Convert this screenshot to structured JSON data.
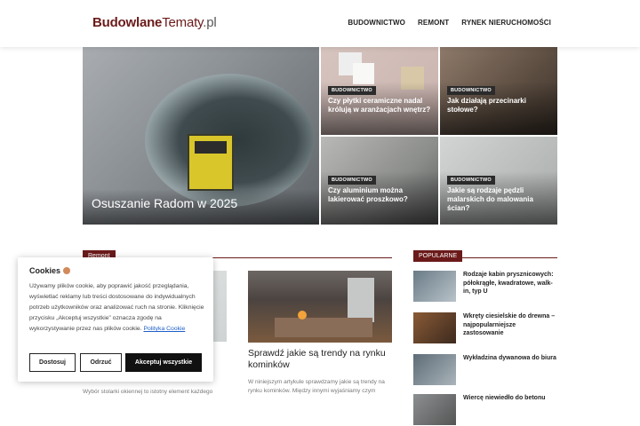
{
  "header": {
    "logo_part1": "Budowlane",
    "logo_part2": "Tematy",
    "logo_part3": ".pl",
    "nav": [
      "BUDOWNICTWO",
      "REMONT",
      "RYNEK NIERUCHOMOŚCI"
    ]
  },
  "hero": {
    "big": {
      "title": "Osuszanie Radom w 2025"
    },
    "tiles": [
      {
        "badge": "BUDOWNICTWO",
        "title": "Czy płytki ceramiczne nadal królują w aranżacjach wnętrz?"
      },
      {
        "badge": "BUDOWNICTWO",
        "title": "Jak działają przecinarki stołowe?"
      },
      {
        "badge": "BUDOWNICTWO",
        "title": "Czy aluminium można lakierować proszkowo?"
      },
      {
        "badge": "BUDOWNICTWO",
        "title": "Jakie są rodzaje pędzli malarskich do malowania ścian?"
      }
    ]
  },
  "sections": {
    "left_label": "Remont",
    "right_label": "POPULARNE"
  },
  "main_card": {
    "title": "Sprawdź jakie są trendy na rynku kominków",
    "excerpt": "W niniejszym artykule sprawdzamy jakie są trendy na rynku kominków. Między innymi wyjaśniamy czym"
  },
  "left_excerpt": "Wybór stolarki okiennej to istotny element każdego",
  "popular": [
    "Rodzaje kabin prysznicowych: półokrągłe, kwadratowe, walk-in, typ U",
    "Wkręty ciesielskie do drewna – najpopularniejsze zastosowanie",
    "Wykładzina dywanowa do biura",
    "Wiercę niewiedło do betonu"
  ],
  "cookie": {
    "title": "Cookies",
    "text": "Używamy plików cookie, aby poprawić jakość przeglądania, wyświetlać reklamy lub treści dostosowane do indywidualnych potrzeb użytkowników oraz analizować ruch na stronie. Kliknięcie przycisku „Akceptuj wszystkie” oznacza zgodę na wykorzystywanie przez nas plików cookie.",
    "link": "Polityka Cookie",
    "btn_customize": "Dostosuj",
    "btn_reject": "Odrzuć",
    "btn_accept": "Akceptuj wszystkie"
  }
}
